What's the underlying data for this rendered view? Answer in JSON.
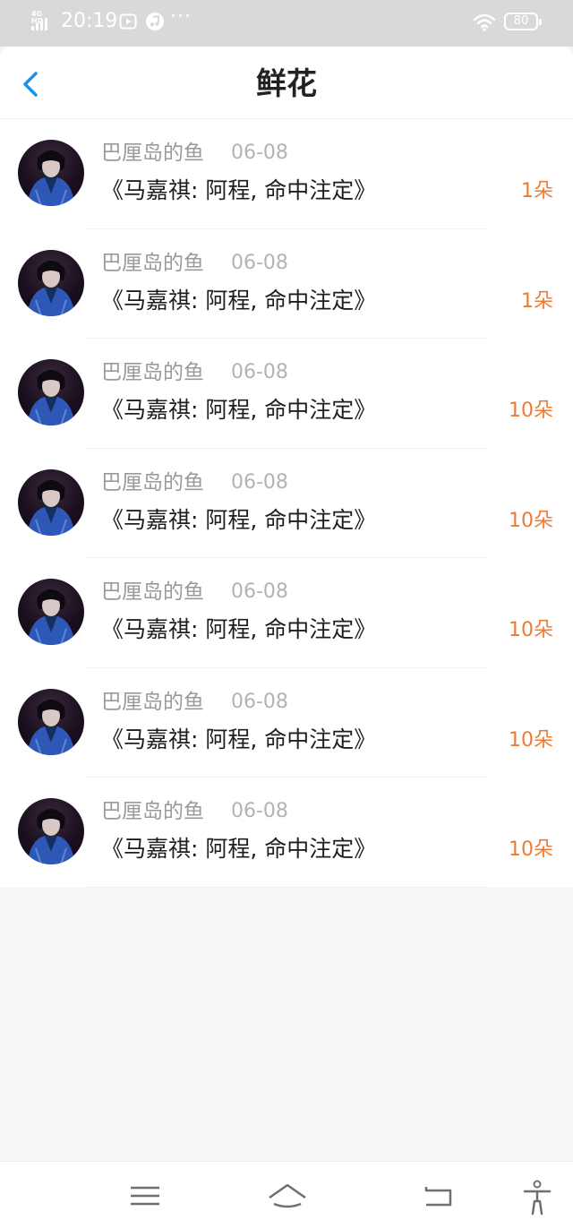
{
  "status_bar": {
    "network": "4G HD",
    "time": "20:19",
    "more": "···",
    "battery": "80"
  },
  "header": {
    "title": "鲜花",
    "back_icon": "chevron-left-icon"
  },
  "colors": {
    "accent_orange": "#ec7c35",
    "accent_blue": "#1a93e6",
    "background": "#f8f7f8"
  },
  "items": [
    {
      "name": "巴厘岛的鱼",
      "date": "06-08",
      "title": "《马嘉祺: 阿程, 命中注定》",
      "amount": "1朵"
    },
    {
      "name": "巴厘岛的鱼",
      "date": "06-08",
      "title": "《马嘉祺: 阿程, 命中注定》",
      "amount": "1朵"
    },
    {
      "name": "巴厘岛的鱼",
      "date": "06-08",
      "title": "《马嘉祺: 阿程, 命中注定》",
      "amount": "10朵"
    },
    {
      "name": "巴厘岛的鱼",
      "date": "06-08",
      "title": "《马嘉祺: 阿程, 命中注定》",
      "amount": "10朵"
    },
    {
      "name": "巴厘岛的鱼",
      "date": "06-08",
      "title": "《马嘉祺: 阿程, 命中注定》",
      "amount": "10朵"
    },
    {
      "name": "巴厘岛的鱼",
      "date": "06-08",
      "title": "《马嘉祺: 阿程, 命中注定》",
      "amount": "10朵"
    },
    {
      "name": "巴厘岛的鱼",
      "date": "06-08",
      "title": "《马嘉祺: 阿程, 命中注定》",
      "amount": "10朵"
    }
  ],
  "bottom_nav": {
    "icons": [
      "menu-icon",
      "home-icon",
      "back-icon",
      "accessibility-icon"
    ]
  }
}
